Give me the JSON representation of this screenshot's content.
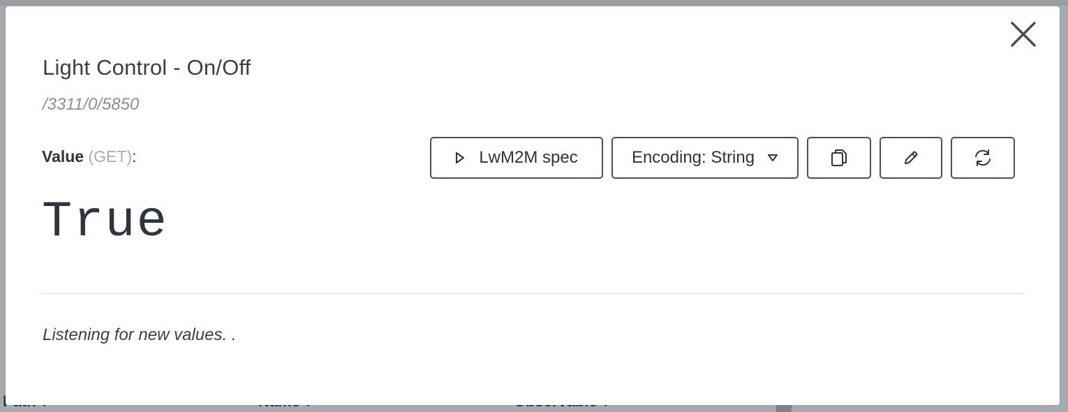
{
  "background": {
    "columns": [
      "Path",
      "Name",
      "Observable"
    ]
  },
  "modal": {
    "title": "Light Control - On/Off",
    "path": "/3311/0/5850",
    "value_label": "Value",
    "value_method": "(GET)",
    "value_colon": ":",
    "value": "True",
    "status": "Listening for new values. .",
    "toolbar": {
      "spec_label": "LwM2M spec",
      "encoding_label": "Encoding: String"
    },
    "icons": {
      "close": "close-icon",
      "spec": "play-icon",
      "encoding": "chevron-down-icon",
      "copy": "copy-icon",
      "edit": "pencil-icon",
      "refresh": "refresh-icon"
    }
  }
}
